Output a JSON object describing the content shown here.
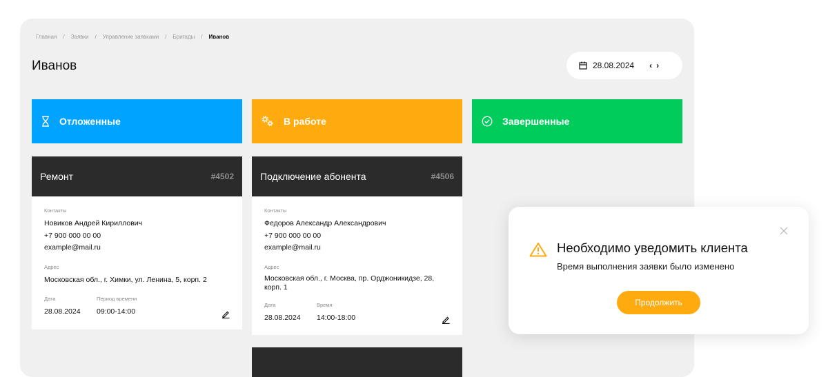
{
  "breadcrumb": [
    "Главная",
    "Заявки",
    "Управление заявками",
    "Бригады",
    "Иванов"
  ],
  "page_title": "Иванов",
  "date_picker": {
    "date": "28.08.2024",
    "prev": "‹",
    "next": "›"
  },
  "columns": [
    {
      "label": "Отложенные",
      "icon": "hourglass-icon",
      "color": "#00a3ff"
    },
    {
      "label": "В работе",
      "icon": "gears-icon",
      "color": "#ffaa0f"
    },
    {
      "label": "Завершенные",
      "icon": "check-circle-icon",
      "color": "#00cc5c"
    }
  ],
  "cards": [
    {
      "title": "Ремонт",
      "number": "#4502",
      "contacts_label": "Контакты",
      "name": "Новиков Андрей Кириллович",
      "phone": "+7 900 000 00 00",
      "email": "example@mail.ru",
      "address_label": "Адрес",
      "address": "Московская обл., г. Химки, ул. Ленина, 5, корп. 2",
      "date_label": "Дата",
      "date": "28.08.2024",
      "time_label": "Период времени",
      "time": "09:00-14:00"
    },
    {
      "title": "Подключение абонента",
      "number": "#4506",
      "contacts_label": "Контакты",
      "name": "Федоров Александр Александрович",
      "phone": "+7 900 000 00 00",
      "email": "example@mail.ru",
      "address_label": "Адрес",
      "address": "Московская обл., г. Москва, пр. Орджоникидзе, 28, корп. 1",
      "date_label": "Дата",
      "date": "28.08.2024",
      "time_label": "Время",
      "time": "14:00-18:00"
    }
  ],
  "modal": {
    "title": "Необходимо уведомить клиента",
    "message": "Время выполнения заявки было изменено",
    "button": "Продолжить"
  },
  "colors": {
    "accent_orange": "#ffaa0f",
    "blue": "#00a3ff",
    "green": "#00cc5c",
    "dark": "#2b2b2b",
    "panel_bg": "#f0f0f0"
  }
}
